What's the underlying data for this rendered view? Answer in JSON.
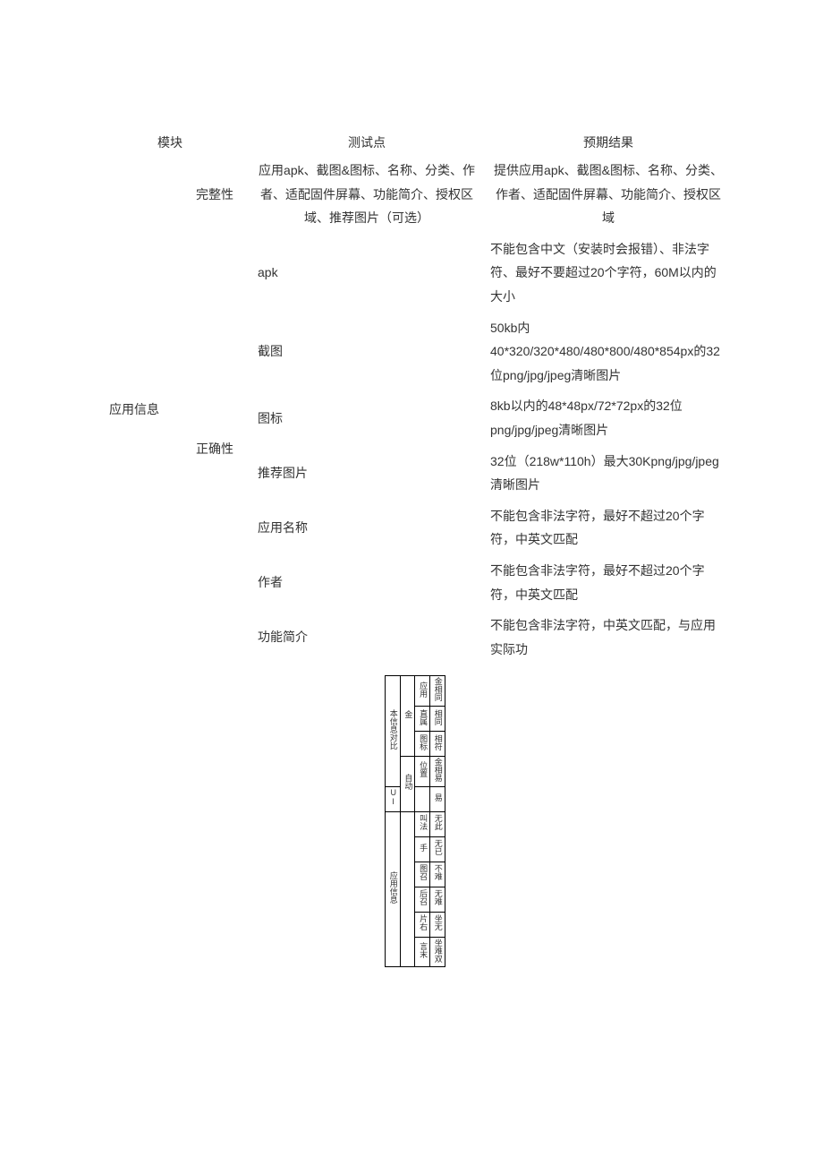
{
  "headers": {
    "module": "模块",
    "test_point": "测试点",
    "expected": "预期结果"
  },
  "module_label": "应用信息",
  "section1": {
    "sub": "完整性",
    "row": {
      "test": "应用apk、截图&图标、名称、分类、作者、适配固件屏幕、功能简介、授权区域、推荐图片（可选）",
      "expect": "提供应用apk、截图&图标、名称、分类、作者、适配固件屏幕、功能简介、授权区域"
    }
  },
  "section2": {
    "sub": "正确性",
    "rows": [
      {
        "test": "apk",
        "expect": "不能包含中文（安装时会报错）、非法字符、最好不要超过20个字符，60M以内的大小"
      },
      {
        "test": "截图",
        "expect": "50kb内40*320/320*480/480*800/480*854px的32位png/jpg/jpeg清晰图片"
      },
      {
        "test": "图标",
        "expect": "8kb以内的48*48px/72*72px的32位png/jpg/jpeg清晰图片"
      },
      {
        "test": "推荐图片",
        "expect": "32位（218w*110h）最大30Kpng/jpg/jpeg清晰图片"
      },
      {
        "test": "应用名称",
        "expect": "不能包含非法字符，最好不超过20个字符，中英文匹配"
      },
      {
        "test": "作者",
        "expect": "不能包含非法字符，最好不超过20个字符，中英文匹配"
      },
      {
        "test": "功能简介",
        "expect": "不能包含非法字符，中英文匹配，与应用实际功"
      }
    ]
  },
  "compressed": {
    "col1_a": "本信息对比",
    "col1_b": "UI",
    "col1_c": "应用信息",
    "rows": [
      {
        "c2": "金",
        "c3": "应用",
        "c4": "金相同"
      },
      {
        "c2": "",
        "c3": "直属",
        "c4": "相同"
      },
      {
        "c2": "",
        "c3": "图标",
        "c4": "相符"
      },
      {
        "c2": "自动",
        "c3": "位置",
        "c4": "金相易"
      },
      {
        "c2": "",
        "c3": "",
        "c4": "易"
      },
      {
        "c2": "",
        "c3": "叫法",
        "c4": "无此"
      },
      {
        "c2": "",
        "c3": "手",
        "c4": "无已"
      },
      {
        "c2": "",
        "c3": "图召",
        "c4": "不难"
      },
      {
        "c2": "",
        "c3": "后召",
        "c4": "无难"
      },
      {
        "c2": "",
        "c3": "片右",
        "c4": "坐无"
      },
      {
        "c2": "",
        "c3": "言末",
        "c4": "坐难双"
      }
    ]
  }
}
